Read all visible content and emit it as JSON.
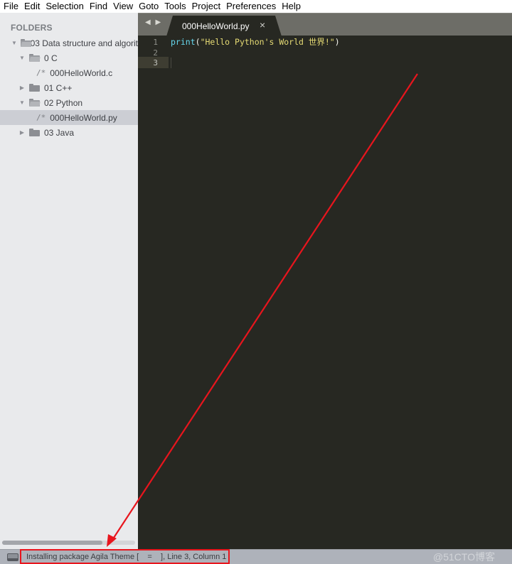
{
  "menubar": {
    "items": [
      "File",
      "Edit",
      "Selection",
      "Find",
      "View",
      "Goto",
      "Tools",
      "Project",
      "Preferences",
      "Help"
    ]
  },
  "sidebar": {
    "title": "FOLDERS",
    "tree": [
      {
        "label": "03 Data structure and algorit",
        "type": "folder",
        "expanded": true,
        "depth": 0
      },
      {
        "label": "0 C",
        "type": "folder",
        "expanded": true,
        "depth": 1
      },
      {
        "label": "000HelloWorld.c",
        "type": "file",
        "icon": "/*",
        "depth": 2
      },
      {
        "label": "01 C++",
        "type": "folder",
        "expanded": false,
        "depth": 1
      },
      {
        "label": "02 Python",
        "type": "folder",
        "expanded": true,
        "depth": 1
      },
      {
        "label": "000HelloWorld.py",
        "type": "file",
        "icon": "/*",
        "depth": 2,
        "selected": true
      },
      {
        "label": "03 Java",
        "type": "folder",
        "expanded": false,
        "depth": 1
      }
    ],
    "scroll_fraction": 0.75
  },
  "tabbar": {
    "nav_arrows": "◀ ▶",
    "active_tab": {
      "label": "000HelloWorld.py",
      "close_icon": "×"
    }
  },
  "editor": {
    "line_numbers": [
      "1",
      "2",
      "3"
    ],
    "current_line": 3,
    "code": {
      "line1": {
        "func": "print",
        "open": "(",
        "string": "\"Hello Python's World 世界!\"",
        "close": ")"
      }
    }
  },
  "statusbar": {
    "text": "Installing package Agila Theme [    =    ], Line 3, Column 1",
    "watermark": "@51CTO博客"
  },
  "annotation": {
    "color": "#e8151d"
  },
  "colors": {
    "editor_bg": "#272822",
    "sidebar_bg": "#e9eaec",
    "statusbar_bg": "#aeb2ba",
    "keyword": "#66d9ef",
    "string": "#e6db74"
  }
}
